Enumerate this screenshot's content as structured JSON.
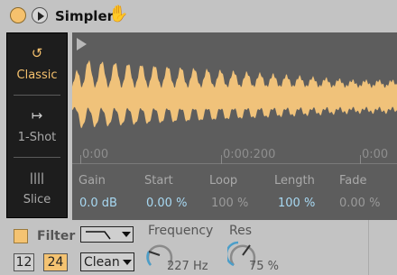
{
  "device": {
    "title": "Simpler",
    "hand_icon": "hand-icon"
  },
  "modes": [
    {
      "label": "Classic",
      "icon": "loop-icon",
      "active": true
    },
    {
      "label": "1-Shot",
      "icon": "oneshot-arrow-icon",
      "active": false
    },
    {
      "label": "Slice",
      "icon": "slice-bars-icon",
      "active": false
    }
  ],
  "timeline": {
    "labels": [
      "0:00",
      "0:00:200",
      "0:00"
    ]
  },
  "params": {
    "gain": {
      "label": "Gain",
      "value": "0.0 dB"
    },
    "start": {
      "label": "Start",
      "value": "0.00 %"
    },
    "loop": {
      "label": "Loop",
      "value": "100 %"
    },
    "length": {
      "label": "Length",
      "value": "100 %"
    },
    "fade": {
      "label": "Fade",
      "value": "0.00 %"
    }
  },
  "filter": {
    "label": "Filter",
    "slope_12": "12",
    "slope_24": "24",
    "circuit": "Clean",
    "frequency_label": "Frequency",
    "frequency_value": "227 Hz",
    "res_label": "Res",
    "res_value": "75 %"
  },
  "colors": {
    "accent": "#f5c16d",
    "value_blue": "#a7d8f2",
    "waveform": "#f0c27a",
    "panel_bg": "#5d5d5d",
    "mode_bg": "#1d1d1d"
  }
}
